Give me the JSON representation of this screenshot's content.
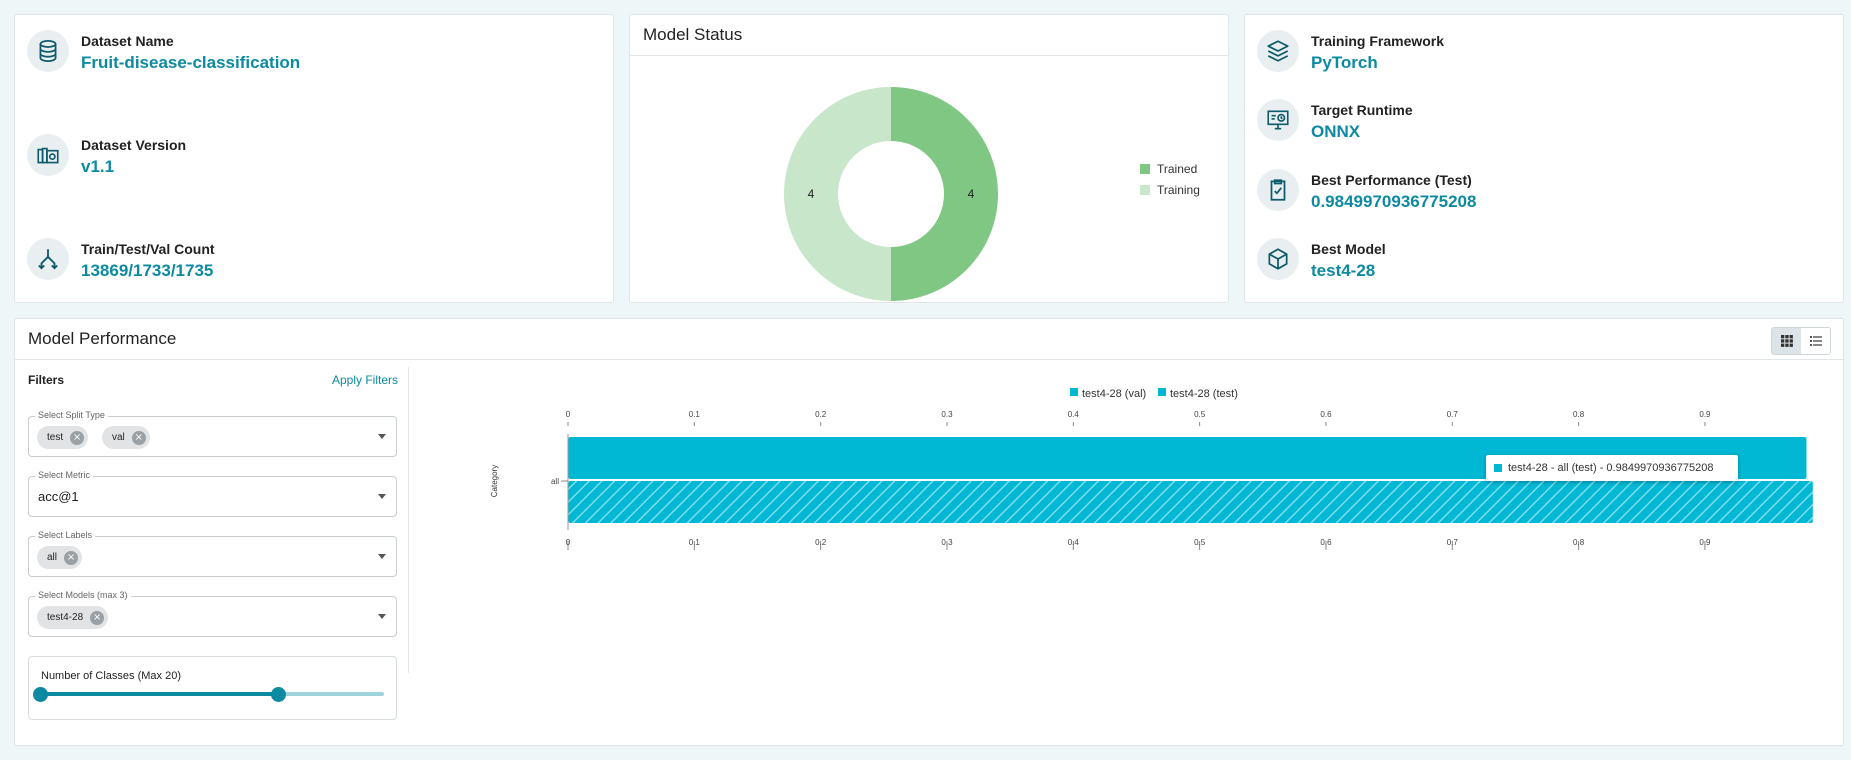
{
  "dataset_card": {
    "items": [
      {
        "icon": "database-icon",
        "label": "Dataset Name",
        "value": "Fruit-disease-classification"
      },
      {
        "icon": "dataset-version-icon",
        "label": "Dataset Version",
        "value": "v1.1"
      },
      {
        "icon": "split-icon",
        "label": "Train/Test/Val Count",
        "value": "13869/1733/1735"
      }
    ]
  },
  "status_card": {
    "title": "Model Status",
    "legend": [
      {
        "label": "Trained",
        "color": "#81c784"
      },
      {
        "label": "Training",
        "color": "#c8e6c9"
      }
    ]
  },
  "model_card": {
    "items": [
      {
        "icon": "layers-icon",
        "label": "Training Framework",
        "value": "PyTorch"
      },
      {
        "icon": "monitor-settings-icon",
        "label": "Target Runtime",
        "value": "ONNX"
      },
      {
        "icon": "clipboard-check-icon",
        "label": "Best Performance (Test)",
        "value": "0.9849970936775208"
      },
      {
        "icon": "cube-icon",
        "label": "Best Model",
        "value": "test4-28"
      }
    ]
  },
  "performance": {
    "title": "Model Performance",
    "filters_title": "Filters",
    "apply_label": "Apply Filters",
    "split_type": {
      "label": "Select Split Type",
      "chips": [
        "test",
        "val"
      ]
    },
    "metric": {
      "label": "Select Metric",
      "value": "acc@1"
    },
    "labels": {
      "label": "Select Labels",
      "chips": [
        "all"
      ]
    },
    "models": {
      "label": "Select Models (max 3)",
      "chips": [
        "test4-28"
      ]
    },
    "classes_slider": {
      "label": "Number of Classes (Max 20)",
      "range_fraction": [
        0.0,
        0.68
      ]
    },
    "tooltip": "test4-28 - all (test) - 0.9849970936775208"
  },
  "chart_data": [
    {
      "type": "pie",
      "variant": "donut",
      "categories": [
        "Trained",
        "Training"
      ],
      "values": [
        4,
        4
      ],
      "colors": [
        "#81c784",
        "#c8e6c9"
      ],
      "legend": "right"
    },
    {
      "type": "bar",
      "orientation": "horizontal",
      "ylabel": "Category",
      "categories": [
        "all"
      ],
      "series": [
        {
          "name": "test4-28 (val)",
          "values": [
            0.98
          ],
          "color": "#00b8d4",
          "pattern": "solid"
        },
        {
          "name": "test4-28 (test)",
          "values": [
            0.9849970936775208
          ],
          "color": "#00b8d4",
          "pattern": "hatched"
        }
      ],
      "xlim": [
        0,
        0.98
      ],
      "xticks": [
        "0",
        "0.1",
        "0.2",
        "0.3",
        "0.4",
        "0.5",
        "0.6",
        "0.7",
        "0.8",
        "0.9"
      ],
      "legend": "top"
    }
  ]
}
